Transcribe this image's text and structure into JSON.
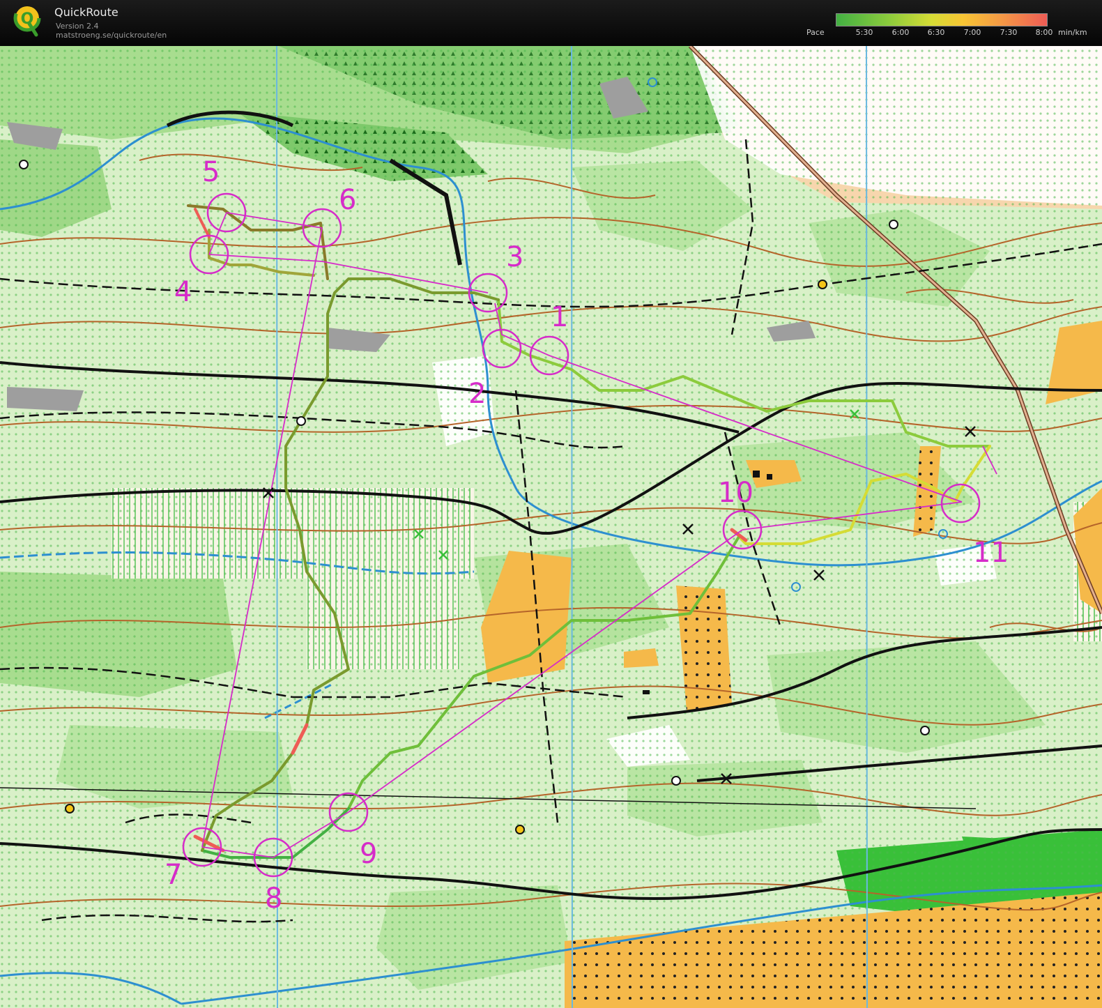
{
  "header": {
    "app_title": "QuickRoute",
    "app_version": "Version 2.4",
    "app_url": "matstroeng.se/quickroute/en",
    "logo_letter": "Q",
    "pace": {
      "label": "Pace",
      "unit": "min/km",
      "ticks": [
        "5:30",
        "6:00",
        "6:30",
        "7:00",
        "7:30",
        "8:00"
      ],
      "colors": [
        "#43b043",
        "#8ccb3c",
        "#d5dc35",
        "#f7c534",
        "#f49a45",
        "#ee5c55"
      ]
    }
  },
  "map": {
    "course_color": "#d62bc9",
    "controls": [
      {
        "number": "1"
      },
      {
        "number": "2"
      },
      {
        "number": "3"
      },
      {
        "number": "4"
      },
      {
        "number": "5"
      },
      {
        "number": "6"
      },
      {
        "number": "7"
      },
      {
        "number": "8"
      },
      {
        "number": "9"
      },
      {
        "number": "10"
      },
      {
        "number": "11"
      }
    ]
  }
}
